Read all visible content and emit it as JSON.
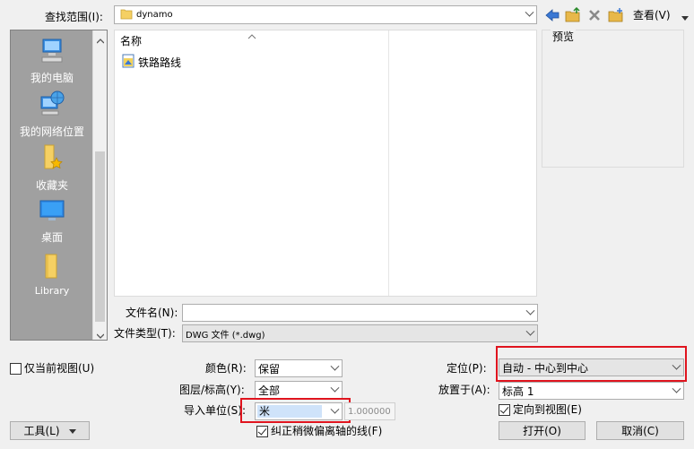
{
  "lookin": {
    "label": "查找范围(I):",
    "value": "dynamo"
  },
  "toolbar": {
    "views_label": "查看(V)"
  },
  "places": [
    {
      "label": "我的电脑"
    },
    {
      "label": "我的网络位置"
    },
    {
      "label": "收藏夹"
    },
    {
      "label": "桌面"
    },
    {
      "label": "Library"
    }
  ],
  "filelist": {
    "column_name": "名称",
    "items": [
      {
        "name": "铁路路线"
      }
    ]
  },
  "preview": {
    "label": "预览"
  },
  "filename": {
    "label": "文件名(N):",
    "value": ""
  },
  "filetype": {
    "label": "文件类型(T):",
    "value": "DWG 文件 (*.dwg)"
  },
  "options": {
    "current_view_only": {
      "label": "仅当前视图(U)",
      "checked": false
    },
    "color": {
      "label": "颜色(R):",
      "value": "保留"
    },
    "layers": {
      "label": "图层/标高(Y):",
      "value": "全部"
    },
    "import_units": {
      "label": "导入单位(S):",
      "value": "米",
      "scale": "1.000000"
    },
    "fix_lines": {
      "label": "纠正稍微偏离轴的线(F)",
      "checked": true
    },
    "positioning": {
      "label": "定位(P):",
      "value": "自动 - 中心到中心"
    },
    "place_at": {
      "label": "放置于(A):",
      "value": "标高 1"
    },
    "orient_to_view": {
      "label": "定向到视图(E)",
      "checked": true
    }
  },
  "buttons": {
    "tools": "工具(L)",
    "open": "打开(O)",
    "cancel": "取消(C)"
  },
  "colors": {
    "highlight": "#e0141e",
    "places_bg": "#a0a0a0"
  }
}
